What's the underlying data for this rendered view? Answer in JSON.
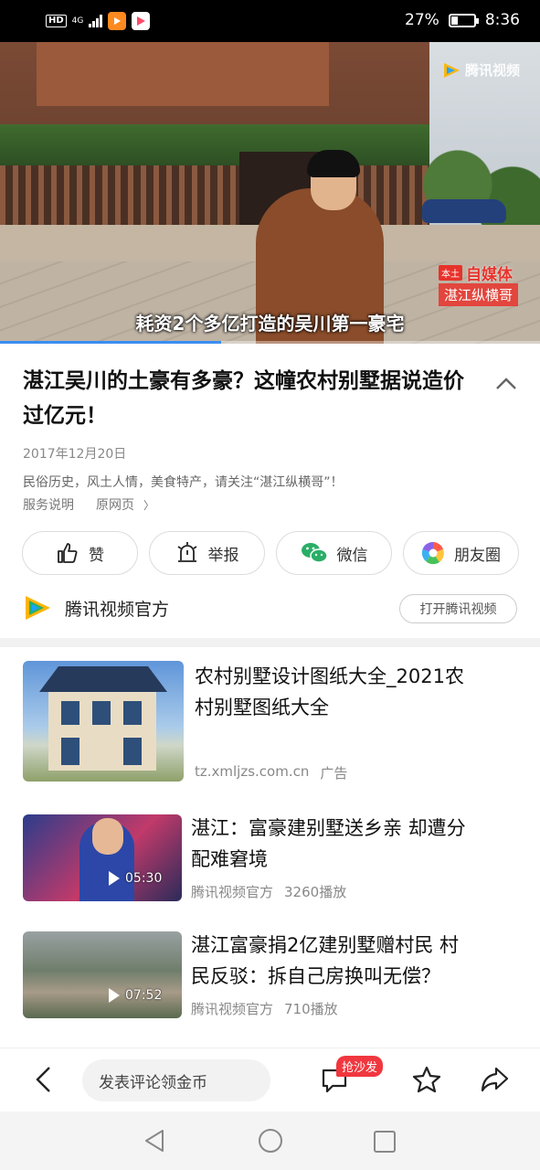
{
  "status_bar": {
    "network_badge": "HD",
    "signal_label": "4G",
    "battery_percent_text": "27%",
    "battery_level": 0.27,
    "time": "8:36"
  },
  "video": {
    "watermark": "腾讯视频",
    "overlay_badge_1": "自媒体",
    "overlay_badge_2": "湛江纵横哥",
    "subtitle": "耗资2个多亿打造的吴川第一豪宅",
    "progress": 0.41
  },
  "article": {
    "title": "湛江吴川的土豪有多豪？这幢农村别墅据说造价过亿元！",
    "date": "2017年12月20日",
    "description": "民俗历史，风土人情，美食特产，请关注“湛江纵横哥”！",
    "service_link": "服务说明",
    "source_link": "原网页"
  },
  "actions": {
    "like": "赞",
    "report": "举报",
    "wechat": "微信",
    "moments": "朋友圈"
  },
  "source": {
    "name": "腾讯视频官方",
    "open_button": "打开腾讯视频"
  },
  "feed": [
    {
      "title_line1": "农村别墅设计图纸大全_2021农",
      "title_line2": "村别墅图纸大全",
      "domain": "tz.xmljzs.com.cn",
      "tag": "广告"
    },
    {
      "title_line1": "湛江：富豪建别墅送乡亲 却遭分",
      "title_line2": "配难窘境",
      "duration": "05:30",
      "channel": "腾讯视频官方",
      "plays": "3260播放"
    },
    {
      "title_line1": "湛江富豪捐2亿建别墅赠村民 村",
      "title_line2": "民反驳：拆自己房换叫无偿？",
      "duration": "07:52",
      "channel": "腾讯视频官方",
      "plays": "710播放"
    }
  ],
  "bottom_bar": {
    "comment_placeholder": "发表评论领金币",
    "sofa_badge": "抢沙发"
  },
  "icons": {
    "back": "chevron-left-icon",
    "comment": "comment-icon",
    "favorite": "star-icon",
    "share": "share-icon"
  },
  "colors": {
    "accent_blue": "#3a8ef0",
    "badge_red": "#f0373f",
    "wechat_green": "#2aae67"
  }
}
